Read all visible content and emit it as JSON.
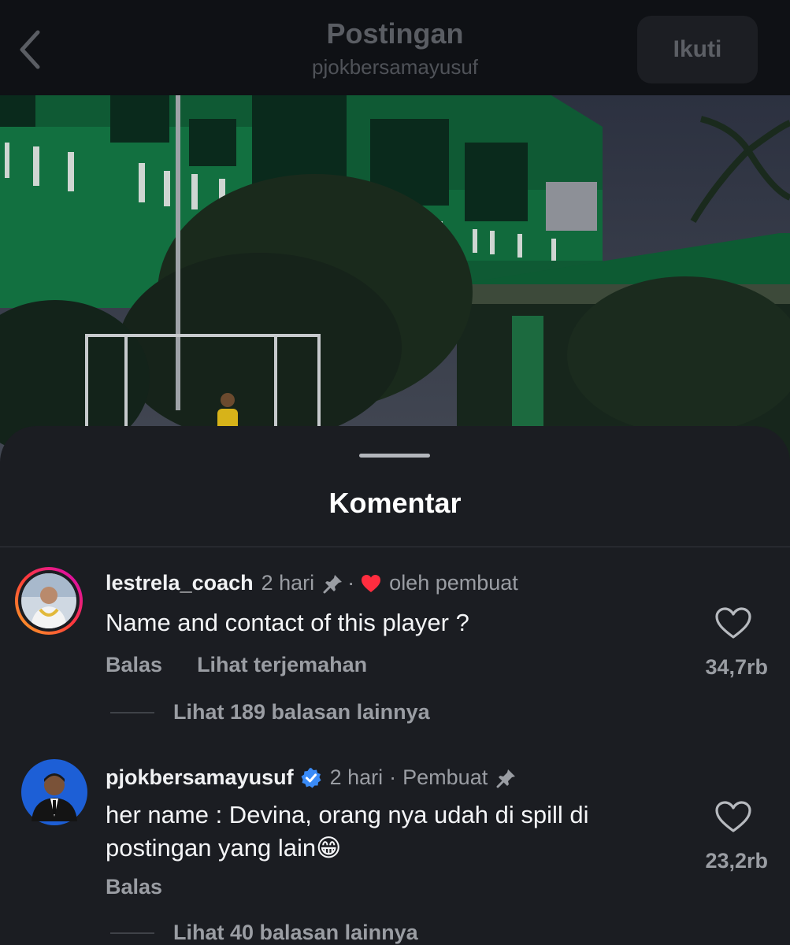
{
  "header": {
    "title": "Postingan",
    "subtitle": "pjokbersamayusuf",
    "follow_label": "Ikuti"
  },
  "sheet": {
    "title": "Komentar"
  },
  "comments": [
    {
      "username": "lestrela_coach",
      "time": "2 hari",
      "separator": "·",
      "creator_like_label": "oleh pembuat",
      "text": "Name and contact of this player ?",
      "reply_label": "Balas",
      "translate_label": "Lihat terjemahan",
      "like_count": "34,7rb",
      "view_replies_label": "Lihat 189 balasan lainnya"
    },
    {
      "username": "pjokbersamayusuf",
      "time": "2 hari",
      "separator": "·",
      "role_label": "Pembuat",
      "text_line1": "her name : Devina, orang nya udah di spill di",
      "text_line2": "postingan yang lain😁",
      "reply_label": "Balas",
      "like_count": "23,2rb",
      "view_replies_label": "Lihat 40 balasan lainnya"
    }
  ],
  "colors": {
    "background": "#0f1115",
    "sheet": "#1b1d22",
    "heart_red": "#ff2d3f",
    "verified_blue": "#3a8bf7",
    "story_ring_start": "#f9a825",
    "story_ring_end": "#d300c5"
  },
  "icons": {
    "back": "chevron-left-icon",
    "pin": "pin-icon",
    "heart_filled": "heart-filled-icon",
    "heart_outline": "heart-outline-icon",
    "verified": "verified-badge-icon"
  }
}
